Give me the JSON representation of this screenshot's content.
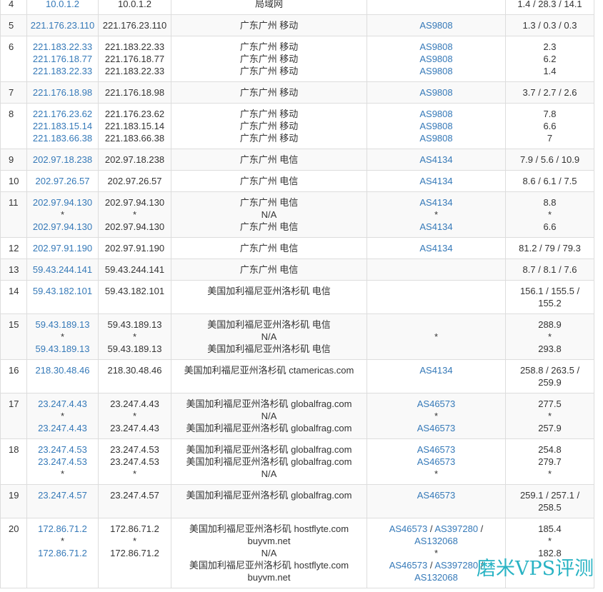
{
  "labels": {
    "as_separator": " / "
  },
  "watermark": "磨米VPS评测",
  "colors": {
    "link": "#3579b8",
    "text": "#333333",
    "border": "#dddddd",
    "stripe": "#f9f9f9",
    "watermark": "#29b3c4"
  },
  "hops": [
    {
      "hop": "4",
      "ips": [
        "10.0.1.2"
      ],
      "hosts": [
        "10.0.1.2"
      ],
      "locations": [
        "局域网"
      ],
      "as": [
        []
      ],
      "rtt": [
        "1.4 / 28.3 / 14.1"
      ]
    },
    {
      "hop": "5",
      "ips": [
        "221.176.23.110"
      ],
      "hosts": [
        "221.176.23.110"
      ],
      "locations": [
        "广东广州 移动"
      ],
      "as": [
        [
          "AS9808"
        ]
      ],
      "rtt": [
        "1.3 / 0.3 / 0.3"
      ]
    },
    {
      "hop": "6",
      "ips": [
        "221.183.22.33",
        "221.176.18.77",
        "221.183.22.33"
      ],
      "hosts": [
        "221.183.22.33",
        "221.176.18.77",
        "221.183.22.33"
      ],
      "locations": [
        "广东广州 移动",
        "广东广州 移动",
        "广东广州 移动"
      ],
      "as": [
        [
          "AS9808"
        ],
        [
          "AS9808"
        ],
        [
          "AS9808"
        ]
      ],
      "rtt": [
        "2.3",
        "6.2",
        "1.4"
      ]
    },
    {
      "hop": "7",
      "ips": [
        "221.176.18.98"
      ],
      "hosts": [
        "221.176.18.98"
      ],
      "locations": [
        "广东广州 移动"
      ],
      "as": [
        [
          "AS9808"
        ]
      ],
      "rtt": [
        "3.7 / 2.7 / 2.6"
      ]
    },
    {
      "hop": "8",
      "ips": [
        "221.176.23.62",
        "221.183.15.14",
        "221.183.66.38"
      ],
      "hosts": [
        "221.176.23.62",
        "221.183.15.14",
        "221.183.66.38"
      ],
      "locations": [
        "广东广州 移动",
        "广东广州 移动",
        "广东广州 移动"
      ],
      "as": [
        [
          "AS9808"
        ],
        [
          "AS9808"
        ],
        [
          "AS9808"
        ]
      ],
      "rtt": [
        "7.8",
        "6.6",
        "7"
      ]
    },
    {
      "hop": "9",
      "ips": [
        "202.97.18.238"
      ],
      "hosts": [
        "202.97.18.238"
      ],
      "locations": [
        "广东广州 电信"
      ],
      "as": [
        [
          "AS4134"
        ]
      ],
      "rtt": [
        "7.9 / 5.6 / 10.9"
      ]
    },
    {
      "hop": "10",
      "ips": [
        "202.97.26.57"
      ],
      "hosts": [
        "202.97.26.57"
      ],
      "locations": [
        "广东广州 电信"
      ],
      "as": [
        [
          "AS4134"
        ]
      ],
      "rtt": [
        "8.6 / 6.1 / 7.5"
      ]
    },
    {
      "hop": "11",
      "ips": [
        "202.97.94.130",
        "*",
        "202.97.94.130"
      ],
      "hosts": [
        "202.97.94.130",
        "*",
        "202.97.94.130"
      ],
      "locations": [
        "广东广州 电信",
        "N/A",
        "广东广州 电信"
      ],
      "as": [
        [
          "AS4134"
        ],
        [
          "*"
        ],
        [
          "AS4134"
        ]
      ],
      "rtt": [
        "8.8",
        "*",
        "6.6"
      ]
    },
    {
      "hop": "12",
      "ips": [
        "202.97.91.190"
      ],
      "hosts": [
        "202.97.91.190"
      ],
      "locations": [
        "广东广州 电信"
      ],
      "as": [
        [
          "AS4134"
        ]
      ],
      "rtt": [
        "81.2 / 79 / 79.3"
      ]
    },
    {
      "hop": "13",
      "ips": [
        "59.43.244.141"
      ],
      "hosts": [
        "59.43.244.141"
      ],
      "locations": [
        "广东广州 电信"
      ],
      "as": [
        []
      ],
      "rtt": [
        "8.7 / 8.1 / 7.6"
      ]
    },
    {
      "hop": "14",
      "ips": [
        "59.43.182.101"
      ],
      "hosts": [
        "59.43.182.101"
      ],
      "locations": [
        "美国加利福尼亚州洛杉矶 电信"
      ],
      "as": [
        []
      ],
      "rtt": [
        "156.1 / 155.5 / 155.2"
      ]
    },
    {
      "hop": "15",
      "ips": [
        "59.43.189.13",
        "*",
        "59.43.189.13"
      ],
      "hosts": [
        "59.43.189.13",
        "*",
        "59.43.189.13"
      ],
      "locations": [
        "美国加利福尼亚州洛杉矶 电信",
        "N/A",
        "美国加利福尼亚州洛杉矶 电信"
      ],
      "as": [
        [],
        [
          "*"
        ],
        []
      ],
      "rtt": [
        "288.9",
        "*",
        "293.8"
      ]
    },
    {
      "hop": "16",
      "ips": [
        "218.30.48.46"
      ],
      "hosts": [
        "218.30.48.46"
      ],
      "locations": [
        "美国加利福尼亚州洛杉矶 ctamericas.com"
      ],
      "as": [
        [
          "AS4134"
        ]
      ],
      "rtt": [
        "258.8 / 263.5 / 259.9"
      ]
    },
    {
      "hop": "17",
      "ips": [
        "23.247.4.43",
        "*",
        "23.247.4.43"
      ],
      "hosts": [
        "23.247.4.43",
        "*",
        "23.247.4.43"
      ],
      "locations": [
        "美国加利福尼亚州洛杉矶 globalfrag.com",
        "N/A",
        "美国加利福尼亚州洛杉矶 globalfrag.com"
      ],
      "as": [
        [
          "AS46573"
        ],
        [
          "*"
        ],
        [
          "AS46573"
        ]
      ],
      "rtt": [
        "277.5",
        "*",
        "257.9"
      ]
    },
    {
      "hop": "18",
      "ips": [
        "23.247.4.53",
        "23.247.4.53",
        "*"
      ],
      "hosts": [
        "23.247.4.53",
        "23.247.4.53",
        "*"
      ],
      "locations": [
        "美国加利福尼亚州洛杉矶 globalfrag.com",
        "美国加利福尼亚州洛杉矶 globalfrag.com",
        "N/A"
      ],
      "as": [
        [
          "AS46573"
        ],
        [
          "AS46573"
        ],
        [
          "*"
        ]
      ],
      "rtt": [
        "254.8",
        "279.7",
        "*"
      ]
    },
    {
      "hop": "19",
      "ips": [
        "23.247.4.57"
      ],
      "hosts": [
        "23.247.4.57"
      ],
      "locations": [
        "美国加利福尼亚州洛杉矶 globalfrag.com"
      ],
      "as": [
        [
          "AS46573"
        ]
      ],
      "rtt": [
        "259.1 / 257.1 / 258.5"
      ]
    },
    {
      "hop": "20",
      "ips": [
        "172.86.71.2",
        "*",
        "172.86.71.2"
      ],
      "hosts": [
        "172.86.71.2",
        "*",
        "172.86.71.2"
      ],
      "locations": [
        "美国加利福尼亚州洛杉矶 hostflyte.com buyvm.net",
        "N/A",
        "美国加利福尼亚州洛杉矶 hostflyte.com buyvm.net"
      ],
      "as": [
        [
          "AS46573",
          "AS397280",
          "AS132068"
        ],
        [
          "*"
        ],
        [
          "AS46573",
          "AS397280",
          "AS132068"
        ]
      ],
      "rtt": [
        "185.4",
        "*",
        "182.8"
      ]
    }
  ]
}
